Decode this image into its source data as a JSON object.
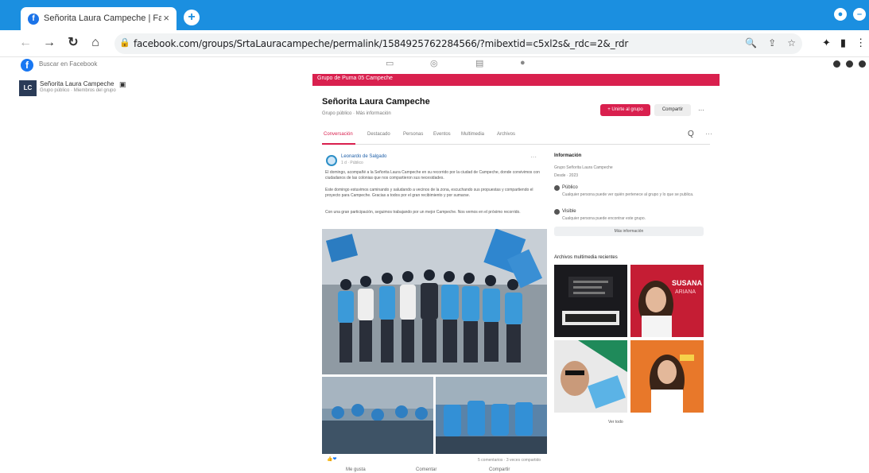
{
  "browser": {
    "tab_title": "Señorita Laura Campeche | Fa",
    "tab_close": "×",
    "new_tab": "+",
    "url": "facebook.com/groups/SrtaLauracampeche/permalink/1584925762284566/?mibextid=c5xl2s&_rdc=2&_rdr",
    "back": "←",
    "forward": "→",
    "reload": "↻",
    "home": "⌂"
  },
  "facebook": {
    "search_placeholder": "Buscar en Facebook",
    "left_group": {
      "name": "Señorita Laura Campeche",
      "subtitle": "Grupo público · Miembros del grupo"
    },
    "group": {
      "banner_text": "Grupo de Puma 05 Campeche",
      "title": "Señorita Laura Campeche",
      "meta": "Grupo público · Más información",
      "join_label": "+ Unirte al grupo",
      "share_label": "Compartir",
      "more": "···",
      "tabs": [
        "Conversación",
        "Destacado",
        "Personas",
        "Eventos",
        "Multimedia",
        "Archivos"
      ],
      "tab_search": "Q",
      "tab_more": "···"
    },
    "post": {
      "author": "Leonardo de Salgado",
      "time": "1 d · Público",
      "more": "···",
      "paragraph1": "El domingo, acompañé a la Señorita Laura Campeche en su recorrido por la ciudad de Campeche, donde convivimos con ciudadanos de las colonias que nos compartieron sus necesidades.",
      "paragraph2": "Este domingo estuvimos caminando y saludando a vecinos de la zona, escuchando sus propuestas y compartiendo el proyecto para Campeche. Gracias a todos por el gran recibimiento y por sumarse.",
      "paragraph3": "Con una gran participación, seguimos trabajando por un mejor Campeche. Nos vemos en el próximo recorrido.",
      "reactions": "👍❤",
      "counts": "5 comentarios · 3 veces compartido",
      "actions": [
        "Me gusta",
        "Comentar",
        "Compartir"
      ]
    },
    "sidebar": {
      "info_title": "Información",
      "info_desc": "Grupo Señorita Laura Campeche",
      "info_date": "Desde · 2023",
      "public_title": "Público",
      "public_desc": "Cualquier persona puede ver quién pertenece al grupo y lo que se publica.",
      "visible_title": "Visible",
      "visible_desc": "Cualquier persona puede encontrar este grupo.",
      "see_more": "Más información",
      "media_title": "Archivos multimedia recientes",
      "see_all": "Ver todo",
      "media_banner_text": "SUSANA",
      "media_sub_text": "ARIANA"
    }
  }
}
